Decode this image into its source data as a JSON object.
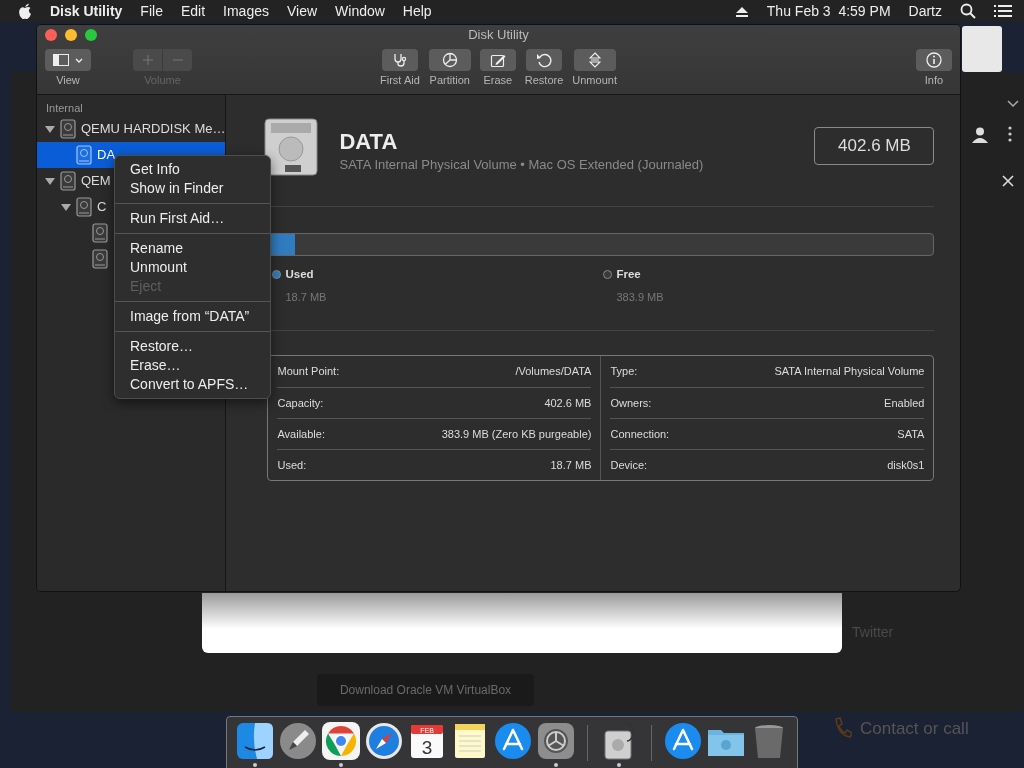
{
  "menubar": {
    "app": "Disk Utility",
    "menus": [
      "File",
      "Edit",
      "Images",
      "View",
      "Window",
      "Help"
    ],
    "clock": "Thu Feb 3  4:59 PM",
    "user": "Dartz"
  },
  "window": {
    "title": "Disk Utility"
  },
  "toolbar": {
    "left": [
      {
        "label": "View",
        "kind": "view",
        "disabled": false
      },
      {
        "label": "Volume",
        "kind": "volume",
        "disabled": true
      }
    ],
    "center": [
      {
        "label": "First Aid",
        "kind": "first-aid",
        "disabled": false
      },
      {
        "label": "Partition",
        "kind": "partition",
        "disabled": false
      },
      {
        "label": "Erase",
        "kind": "erase",
        "disabled": false
      },
      {
        "label": "Restore",
        "kind": "restore",
        "disabled": false
      },
      {
        "label": "Unmount",
        "kind": "unmount",
        "disabled": false
      }
    ],
    "right": [
      {
        "label": "Info",
        "kind": "info",
        "disabled": false
      }
    ]
  },
  "sidebar": {
    "section": "Internal",
    "items": [
      {
        "label": "QEMU HARDDISK Me…",
        "expanded": true,
        "selected": false,
        "children": [
          {
            "label": "DA",
            "selected": true
          }
        ]
      },
      {
        "label": "QEM",
        "expanded": true,
        "selected": false,
        "children": [
          {
            "label": "C",
            "expanded": true,
            "selected": false,
            "children": [
              {
                "selected": false
              },
              {
                "selected": false
              }
            ]
          }
        ]
      }
    ]
  },
  "context_menu": {
    "groups": [
      [
        {
          "label": "Get Info",
          "disabled": false
        },
        {
          "label": "Show in Finder",
          "disabled": false
        }
      ],
      [
        {
          "label": "Run First Aid…",
          "disabled": false
        }
      ],
      [
        {
          "label": "Rename",
          "disabled": false
        },
        {
          "label": "Unmount",
          "disabled": false
        },
        {
          "label": "Eject",
          "disabled": true
        }
      ],
      [
        {
          "label": "Image from “DATA”",
          "disabled": false
        }
      ],
      [
        {
          "label": "Restore…",
          "disabled": false
        },
        {
          "label": "Erase…",
          "disabled": false
        },
        {
          "label": "Convert to APFS…",
          "disabled": false
        }
      ]
    ]
  },
  "volume": {
    "name": "DATA",
    "description": "SATA Internal Physical Volume • Mac OS Extended (Journaled)",
    "size": "402.6 MB",
    "usage": {
      "level": 0.046,
      "legend": [
        {
          "label": "Used",
          "value": "18.7 MB",
          "color": "#2f7fc1"
        },
        {
          "label": "Free",
          "value": "383.9 MB",
          "color": "#3a3a3a"
        }
      ]
    },
    "details": [
      [
        {
          "label": "Mount Point:",
          "value": "/Volumes/DATA"
        },
        {
          "label": "Capacity:",
          "value": "402.6 MB"
        },
        {
          "label": "Available:",
          "value": "383.9 MB (Zero KB purgeable)"
        },
        {
          "label": "Used:",
          "value": "18.7 MB"
        }
      ],
      [
        {
          "label": "Type:",
          "value": "SATA Internal Physical Volume"
        },
        {
          "label": "Owners:",
          "value": "Enabled"
        },
        {
          "label": "Connection:",
          "value": "SATA"
        },
        {
          "label": "Device:",
          "value": "disk0s1"
        }
      ]
    ]
  },
  "background": {
    "download_button": "Download Oracle VM VirtualBox",
    "links": [
      "Twitter",
      "Contact or call"
    ]
  },
  "dock": [
    {
      "kind": "finder",
      "running": true
    },
    {
      "kind": "rocket",
      "running": false
    },
    {
      "kind": "browser",
      "running": true
    },
    {
      "kind": "compass",
      "running": false
    },
    {
      "kind": "calendar",
      "running": false,
      "month": "FEB",
      "day": "3"
    },
    {
      "kind": "notes",
      "running": false
    },
    {
      "kind": "store",
      "running": false
    },
    {
      "kind": "settings",
      "running": true
    },
    {
      "kind": "disk",
      "running": true
    },
    {
      "kind": "store",
      "running": false
    },
    {
      "kind": "folder",
      "running": false
    },
    {
      "kind": "trash",
      "running": false
    }
  ]
}
